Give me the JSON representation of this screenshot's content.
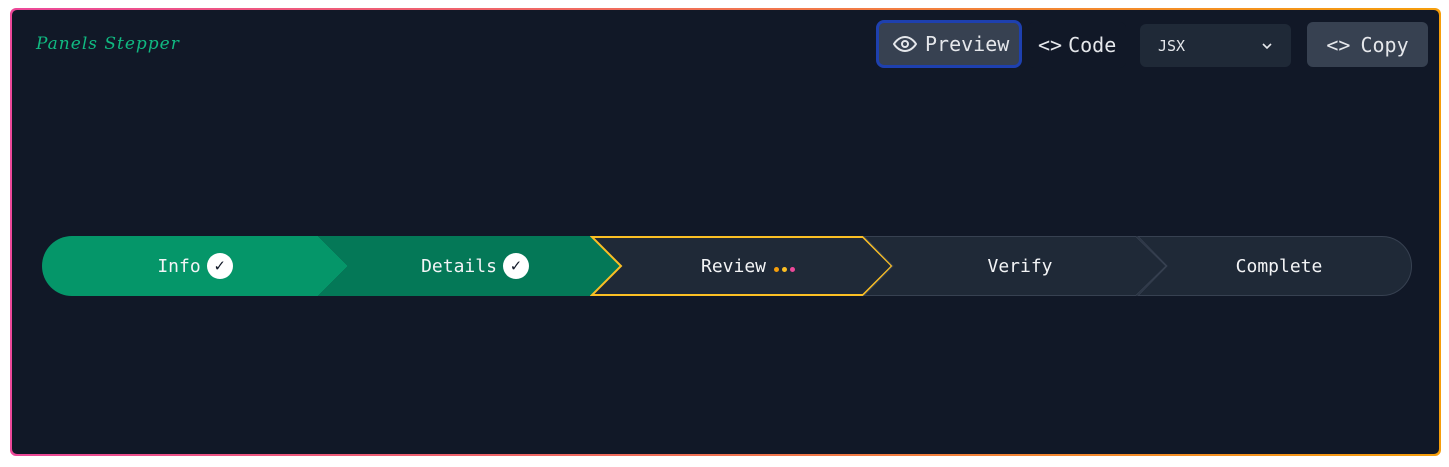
{
  "header": {
    "title": "Panels Stepper",
    "preview_label": "Preview",
    "code_label": "Code",
    "language_select": "JSX",
    "copy_label": "Copy"
  },
  "stepper": {
    "steps": [
      {
        "label": "Info",
        "status": "complete"
      },
      {
        "label": "Details",
        "status": "complete"
      },
      {
        "label": "Review",
        "status": "current"
      },
      {
        "label": "Verify",
        "status": "upcoming"
      },
      {
        "label": "Complete",
        "status": "upcoming"
      }
    ],
    "check_glyph": "✓"
  },
  "colors": {
    "background": "#111827",
    "complete_1": "#059669",
    "complete_2": "#047857",
    "current_border": "#fbbf24",
    "upcoming_fill": "#1f2937",
    "title": "#10b981",
    "dot_colors": [
      "#f59e0b",
      "#fbbf24",
      "#ec4899"
    ]
  }
}
